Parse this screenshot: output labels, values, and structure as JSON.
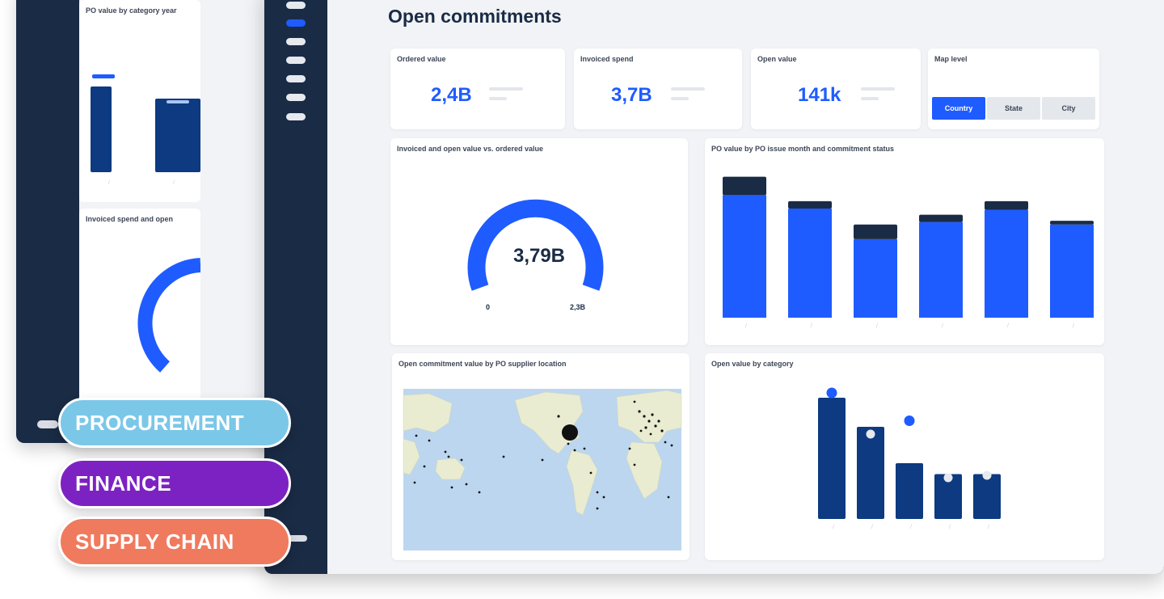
{
  "back": {
    "card1_title": "PO value by category year",
    "card2_title": "Invoiced spend and open"
  },
  "page_title": "Open commitments",
  "kpis": [
    {
      "label": "Ordered value",
      "value": "2,4B"
    },
    {
      "label": "Invoiced spend",
      "value": "3,7B"
    },
    {
      "label": "Open value",
      "value": "141k"
    }
  ],
  "map_level": {
    "label": "Map level",
    "options": [
      "Country",
      "State",
      "City"
    ],
    "selected": "Country"
  },
  "gauge": {
    "title": "Invoiced and open value vs. ordered value",
    "value": "3,79B",
    "min": "0",
    "max": "2,3B"
  },
  "monthly_chart_title": "PO value by PO issue month and commitment status",
  "map_title": "Open commitment value by PO supplier location",
  "category_chart_title": "Open value by category",
  "tags": [
    "PROCUREMENT",
    "FINANCE",
    "SUPPLY CHAIN"
  ],
  "colors": {
    "navy": "#1a2b45",
    "blue": "#1f5cff",
    "dark_blue": "#0d3a80",
    "procurement": "#7bc7e8",
    "finance": "#7d22c2",
    "supply_chain": "#f07a5e"
  },
  "chart_data": [
    {
      "type": "bar",
      "series": [
        {
          "values": [
            100,
            89,
            64,
            78,
            88,
            76
          ]
        },
        {
          "values": [
            15,
            6,
            12,
            6,
            7,
            3
          ]
        }
      ],
      "ylim": [
        0,
        120
      ]
    },
    {
      "type": "bar",
      "values": [
        100,
        76,
        46,
        37,
        37
      ],
      "markers": [
        104,
        70,
        81,
        34,
        36
      ],
      "marker_style": [
        "blue",
        "white",
        "blue",
        "white",
        "white"
      ],
      "ylim": [
        0,
        110
      ]
    }
  ]
}
